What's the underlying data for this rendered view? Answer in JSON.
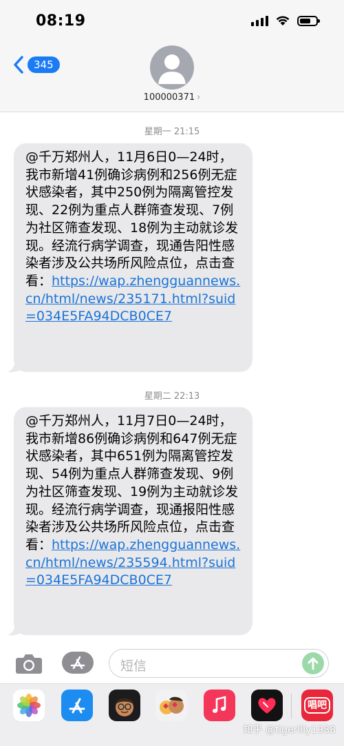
{
  "status_bar": {
    "time": "08:19"
  },
  "header": {
    "back_badge": "345",
    "contact_number": "100000371",
    "contact_chevron": "›"
  },
  "messages": [
    {
      "timestamp": "星期一 21:15",
      "text": "@千万郑州人，11月6日0—24时，我市新增41例确诊病例和256例无症状感染者，其中250例为隔离管控发现、22例为重点人群筛查发现、7例为社区筛查发现、18例为主动就诊发现。经流行病学调查，现通告阳性感染者涉及公共场所风险点位，点击查看：",
      "link": "https://wap.zhengguannews.cn/html/news/235171.html?suid=034E5FA94DCB0CE7"
    },
    {
      "timestamp": "星期二 22:13",
      "text": "@千万郑州人，11月7日0—24时，我市新增86例确诊病例和647例无症状感染者，其中651例为隔离管控发现、54例为重点人群筛查发现、9例为社区筛查发现、19例为主动就诊发现。经流行病学调查，现通报阳性感染者涉及公共场所风险点位，点击查看：",
      "link": "https://wap.zhengguannews.cn/html/news/235594.html?suid=034E5FA94DCB0CE7"
    }
  ],
  "input_bar": {
    "placeholder": "短信"
  },
  "dock": {
    "apps": [
      "photos-icon",
      "app-store-icon",
      "memoji-icon",
      "memoji-stickers-icon",
      "music-icon",
      "heart-app-icon",
      "changba-app-icon"
    ],
    "changba_label": "唱吧"
  },
  "watermark": "知乎 @tigerlily1988",
  "colors": {
    "bubble": "#e9e9eb",
    "link": "#1a73d8",
    "badge": "#1a7bf5",
    "send": "#9bd9a8"
  }
}
